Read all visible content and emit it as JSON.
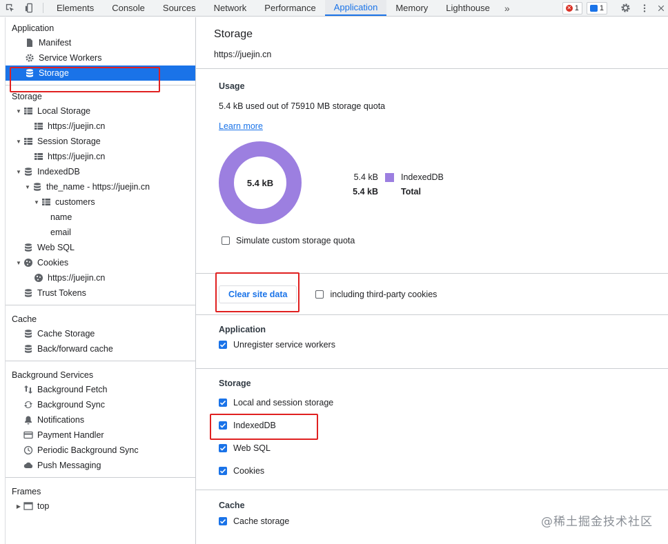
{
  "tabs": [
    "Elements",
    "Console",
    "Sources",
    "Network",
    "Performance",
    "Application",
    "Memory",
    "Lighthouse"
  ],
  "active_tab": "Application",
  "more_tabs_label": "»",
  "error_count": "1",
  "message_count": "1",
  "sidebar": {
    "application": {
      "title": "Application",
      "items": [
        "Manifest",
        "Service Workers",
        "Storage"
      ]
    },
    "storage": {
      "title": "Storage",
      "local_storage": "Local Storage",
      "local_origin": "https://juejin.cn",
      "session_storage": "Session Storage",
      "session_origin": "https://juejin.cn",
      "indexeddb": "IndexedDB",
      "db": "the_name - https://juejin.cn",
      "store": "customers",
      "index_name": "name",
      "index_email": "email",
      "websql": "Web SQL",
      "cookies": "Cookies",
      "cookie_origin": "https://juejin.cn",
      "trust_tokens": "Trust Tokens"
    },
    "cache": {
      "title": "Cache",
      "items": [
        "Cache Storage",
        "Back/forward cache"
      ]
    },
    "background": {
      "title": "Background Services",
      "items": [
        "Background Fetch",
        "Background Sync",
        "Notifications",
        "Payment Handler",
        "Periodic Background Sync",
        "Push Messaging"
      ]
    },
    "frames": {
      "title": "Frames",
      "top": "top"
    }
  },
  "main": {
    "title": "Storage",
    "origin": "https://juejin.cn",
    "usage": {
      "title": "Usage",
      "summary": "5.4 kB used out of 75910 MB storage quota",
      "learn_more": "Learn more",
      "donut_label": "5.4 kB",
      "donut_color": "#9c7fe0",
      "legend": [
        {
          "value": "5.4 kB",
          "name": "IndexedDB",
          "color": "#9c7fe0"
        }
      ],
      "total_value": "5.4 kB",
      "total_label": "Total",
      "simulate_label": "Simulate custom storage quota"
    },
    "clear": {
      "button": "Clear site data",
      "third_party": "including third-party cookies"
    },
    "application": {
      "title": "Application",
      "unregister": "Unregister service workers"
    },
    "storage": {
      "title": "Storage",
      "items": [
        "Local and session storage",
        "IndexedDB",
        "Web SQL",
        "Cookies"
      ]
    },
    "cache": {
      "title": "Cache",
      "items": [
        "Cache storage"
      ]
    }
  },
  "watermark": "@稀土掘金技术社区"
}
